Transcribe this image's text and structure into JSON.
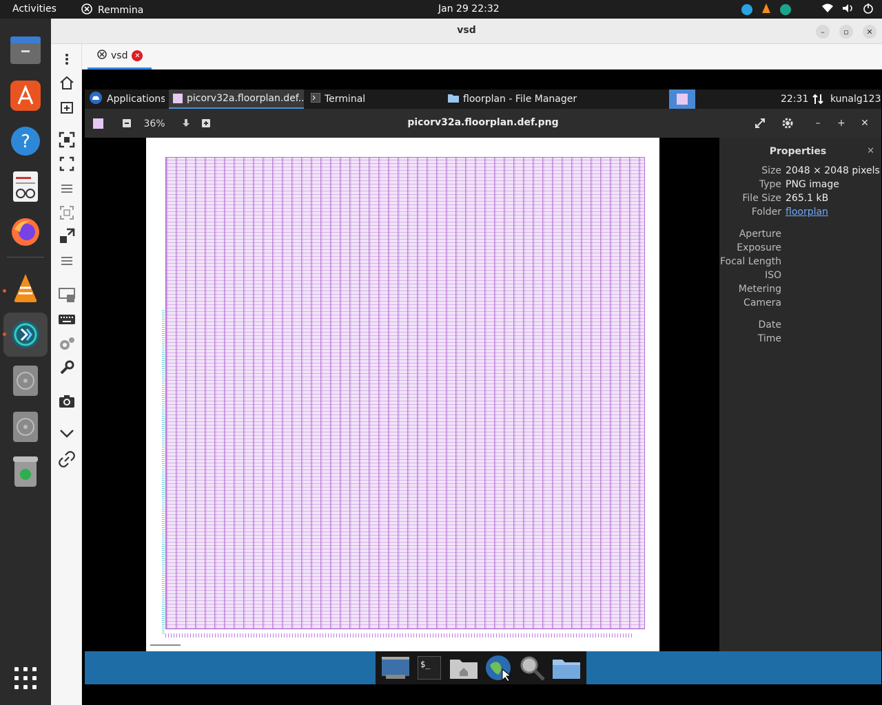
{
  "topbar": {
    "activities": "Activities",
    "app_name": "Remmina",
    "datetime": "Jan 29  22:32"
  },
  "dock": {
    "items": [
      "files-icon",
      "app-center-icon",
      "help-icon",
      "text-editor-icon",
      "firefox-icon",
      "vlc-icon",
      "remmina-icon",
      "disc-icon",
      "disc-icon",
      "trash-icon",
      "app-grid-icon"
    ]
  },
  "window": {
    "title": "vsd",
    "tab_label": "vsd"
  },
  "xfce_panel": {
    "applications": "Applications",
    "task1": "picorv32a.floorplan.def....",
    "task2": "Terminal",
    "task3": "floorplan - File Manager",
    "clock": "22:31",
    "user": "kunalg123"
  },
  "viewer": {
    "zoom": "36%",
    "title": "picorv32a.floorplan.def.png"
  },
  "properties": {
    "title": "Properties",
    "rows": [
      {
        "key": "Size",
        "value": "2048 × 2048 pixels"
      },
      {
        "key": "Type",
        "value": "PNG image"
      },
      {
        "key": "File Size",
        "value": "265.1 kB"
      },
      {
        "key": "Folder",
        "value": "floorplan"
      }
    ],
    "exif": [
      "Aperture",
      "Exposure",
      "Focal Length",
      "ISO",
      "Metering",
      "Camera"
    ],
    "datetime": [
      "Date",
      "Time"
    ]
  }
}
